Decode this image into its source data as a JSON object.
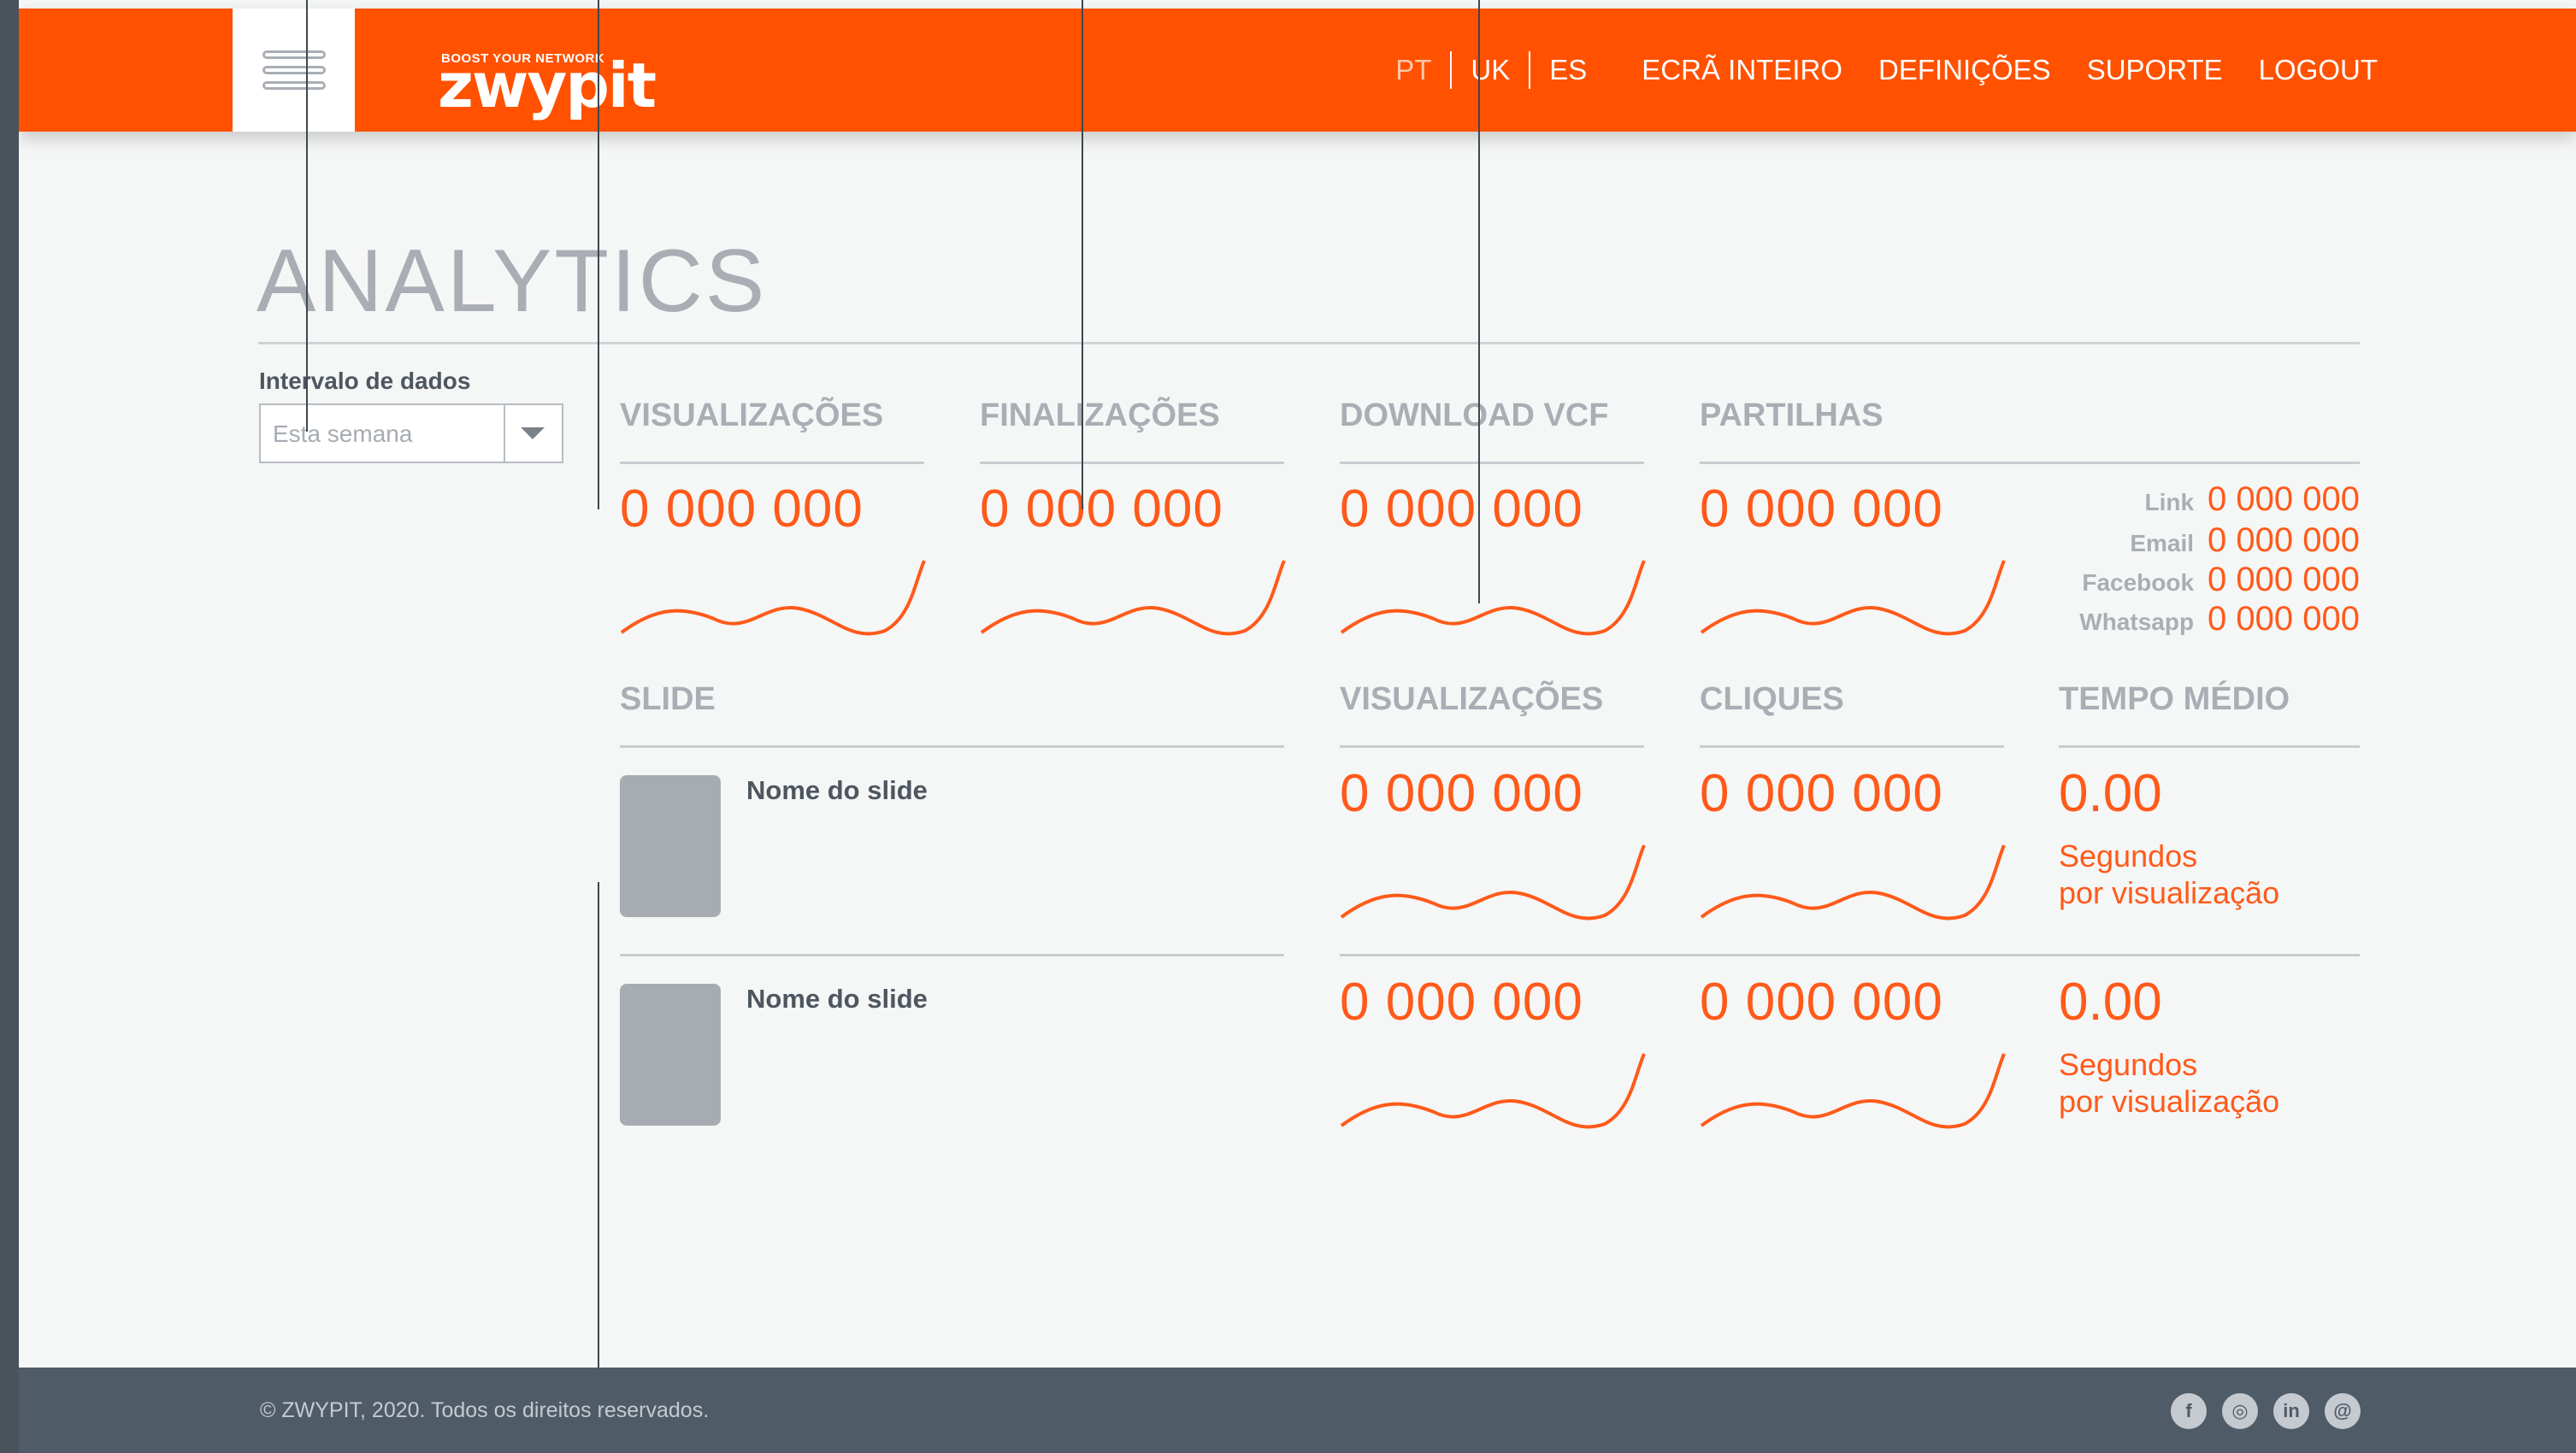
{
  "header": {
    "logo_tagline": "BOOST YOUR NETWORK",
    "logo_word": "zwypit",
    "languages": [
      "PT",
      "UK",
      "ES"
    ],
    "nav": [
      "ECRÃ INTEIRO",
      "DEFINIÇÕES",
      "SUPORTE",
      "LOGOUT"
    ]
  },
  "page": {
    "title": "ANALYTICS"
  },
  "filter": {
    "label": "Intervalo de dados",
    "selected": "Esta semana"
  },
  "metrics": {
    "views": {
      "label": "VISUALIZAÇÕES",
      "value": "0 000 000"
    },
    "completions": {
      "label": "FINALIZAÇÕES",
      "value": "0 000 000"
    },
    "download_vcf": {
      "label": "DOWNLOAD VCF",
      "value": "0 000 000"
    },
    "shares": {
      "label": "PARTILHAS",
      "value": "0 000 000",
      "breakdown": [
        {
          "label": "Link",
          "value": "0 000 000"
        },
        {
          "label": "Email",
          "value": "0 000 000"
        },
        {
          "label": "Facebook",
          "value": "0 000 000"
        },
        {
          "label": "Whatsapp",
          "value": "0 000 000"
        }
      ]
    }
  },
  "slides_table": {
    "headers": {
      "slide": "SLIDE",
      "views": "VISUALIZAÇÕES",
      "clicks": "CLIQUES",
      "avg_time": "TEMPO MÉDIO"
    },
    "rows": [
      {
        "name": "Nome do slide",
        "views": "0 000 000",
        "clicks": "0 000 000",
        "avg": "0.00",
        "avg_unit_1": "Segundos",
        "avg_unit_2": "por visualização"
      },
      {
        "name": "Nome do slide",
        "views": "0 000 000",
        "clicks": "0 000 000",
        "avg": "0.00",
        "avg_unit_1": "Segundos",
        "avg_unit_2": "por visualização"
      }
    ]
  },
  "footer": {
    "copyright": "© ZWYPIT, 2020. Todos os direitos reservados.",
    "social_icons": [
      "facebook-icon",
      "instagram-icon",
      "linkedin-icon",
      "email-icon"
    ]
  },
  "colors": {
    "accent": "#ff5100",
    "footer": "#4f5b66",
    "muted": "#a9aeb5"
  }
}
